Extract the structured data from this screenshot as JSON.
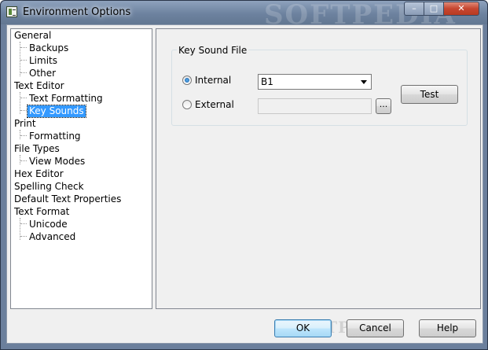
{
  "window": {
    "title": "Environment Options",
    "watermark": "SOFTPEDIA",
    "controls": {
      "minimize": "–",
      "maximize": "□",
      "close": "✕"
    }
  },
  "tree": {
    "items": [
      {
        "label": "General"
      },
      {
        "label": "Backups"
      },
      {
        "label": "Limits"
      },
      {
        "label": "Other"
      },
      {
        "label": "Text Editor"
      },
      {
        "label": "Text Formatting"
      },
      {
        "label": "Key Sounds",
        "selected": true
      },
      {
        "label": "Print"
      },
      {
        "label": "Formatting"
      },
      {
        "label": "File Types"
      },
      {
        "label": "View Modes"
      },
      {
        "label": "Hex Editor"
      },
      {
        "label": "Spelling Check"
      },
      {
        "label": "Default Text Properties"
      },
      {
        "label": "Text Format"
      },
      {
        "label": "Unicode"
      },
      {
        "label": "Advanced"
      }
    ]
  },
  "key_sound": {
    "group_title": "Key Sound File",
    "internal_label": "Internal",
    "internal_checked": true,
    "external_label": "External",
    "external_checked": false,
    "internal_value": "B1",
    "external_value": "",
    "browse_label": "...",
    "test_label": "Test"
  },
  "buttons": {
    "ok": "OK",
    "cancel": "Cancel",
    "help": "Help"
  },
  "footer_watermark": "SOFTPEDIA"
}
